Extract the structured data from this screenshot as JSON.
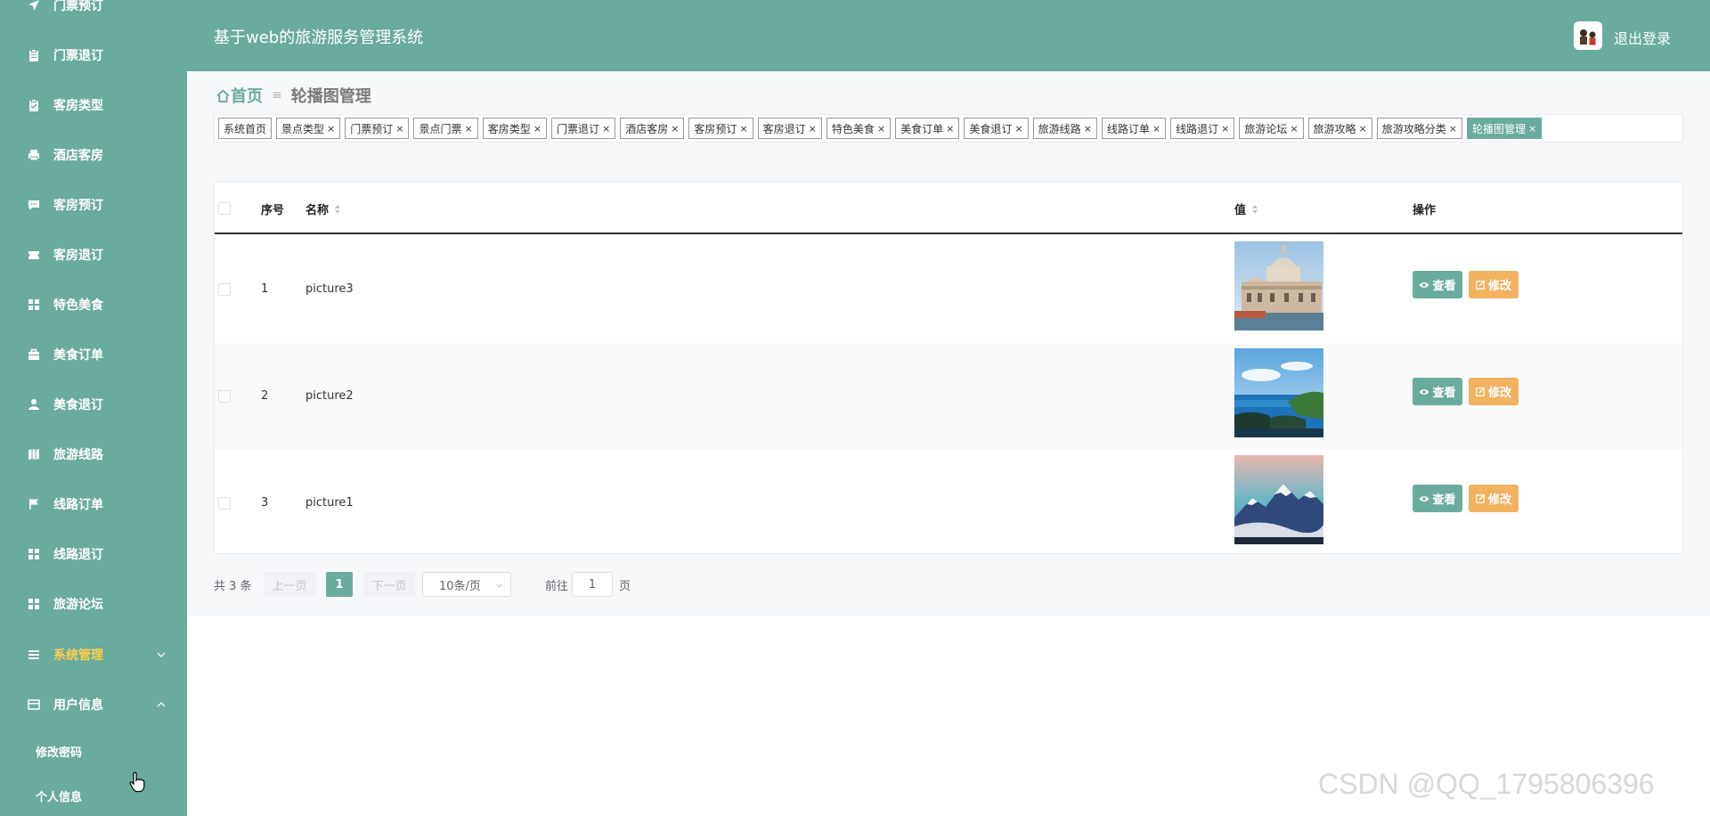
{
  "header": {
    "title": "基于web的旅游服务管理系统",
    "logout_label": "退出登录"
  },
  "sidebar": {
    "items": [
      {
        "label": "门票预订",
        "icon": "send-icon"
      },
      {
        "label": "门票退订",
        "icon": "clipboard-icon"
      },
      {
        "label": "客房类型",
        "icon": "clipboard-check-icon"
      },
      {
        "label": "酒店客房",
        "icon": "printer-icon"
      },
      {
        "label": "客房预订",
        "icon": "chat-icon"
      },
      {
        "label": "客房退订",
        "icon": "ticket-icon"
      },
      {
        "label": "特色美食",
        "icon": "grid-icon"
      },
      {
        "label": "美食订单",
        "icon": "briefcase-icon"
      },
      {
        "label": "美食退订",
        "icon": "user-icon"
      },
      {
        "label": "旅游线路",
        "icon": "map-icon"
      },
      {
        "label": "线路订单",
        "icon": "flag-icon"
      },
      {
        "label": "线路退订",
        "icon": "grid-icon"
      },
      {
        "label": "旅游论坛",
        "icon": "grid-icon"
      },
      {
        "label": "系统管理",
        "icon": "list-icon",
        "expanded": false
      },
      {
        "label": "用户信息",
        "icon": "card-icon",
        "expanded": true
      }
    ],
    "subitems": [
      {
        "label": "修改密码"
      },
      {
        "label": "个人信息"
      }
    ],
    "color": "#6aab9d",
    "active_text_color": "#ffd04b"
  },
  "breadcrumb": {
    "home": "首页",
    "current": "轮播图管理"
  },
  "tags": [
    {
      "label": "系统首页",
      "closable": false,
      "active": false
    },
    {
      "label": "景点类型",
      "closable": true,
      "active": false
    },
    {
      "label": "门票预订",
      "closable": true,
      "active": false
    },
    {
      "label": "景点门票",
      "closable": true,
      "active": false
    },
    {
      "label": "客房类型",
      "closable": true,
      "active": false
    },
    {
      "label": "门票退订",
      "closable": true,
      "active": false
    },
    {
      "label": "酒店客房",
      "closable": true,
      "active": false
    },
    {
      "label": "客房预订",
      "closable": true,
      "active": false
    },
    {
      "label": "客房退订",
      "closable": true,
      "active": false
    },
    {
      "label": "特色美食",
      "closable": true,
      "active": false
    },
    {
      "label": "美食订单",
      "closable": true,
      "active": false
    },
    {
      "label": "美食退订",
      "closable": true,
      "active": false
    },
    {
      "label": "旅游线路",
      "closable": true,
      "active": false
    },
    {
      "label": "线路订单",
      "closable": true,
      "active": false
    },
    {
      "label": "线路退订",
      "closable": true,
      "active": false
    },
    {
      "label": "旅游论坛",
      "closable": true,
      "active": false
    },
    {
      "label": "旅游攻略",
      "closable": true,
      "active": false
    },
    {
      "label": "旅游攻略分类",
      "closable": true,
      "active": false
    },
    {
      "label": "轮播图管理",
      "closable": true,
      "active": true
    }
  ],
  "tag_close_glyph": "×",
  "table": {
    "columns": {
      "index": "序号",
      "name": "名称",
      "value": "值",
      "actions": "操作"
    },
    "rows": [
      {
        "index": "1",
        "name": "picture3",
        "image": "venice-church-thumbnail"
      },
      {
        "index": "2",
        "name": "picture2",
        "image": "coastline-thumbnail"
      },
      {
        "index": "3",
        "name": "picture1",
        "image": "snow-mountain-thumbnail"
      }
    ],
    "view_label": "查看",
    "edit_label": "修改"
  },
  "pagination": {
    "total_text": "共 3 条",
    "prev_label": "上一页",
    "next_label": "下一页",
    "current_page": "1",
    "page_size_label": "10条/页",
    "goto_label": "前往",
    "goto_value": "1",
    "page_suffix": "页"
  },
  "watermark": "CSDN @QQ_1795806396",
  "colors": {
    "primary": "#6aab9d",
    "warning": "#f2b25f",
    "content_bg": "#f7f8fa"
  }
}
